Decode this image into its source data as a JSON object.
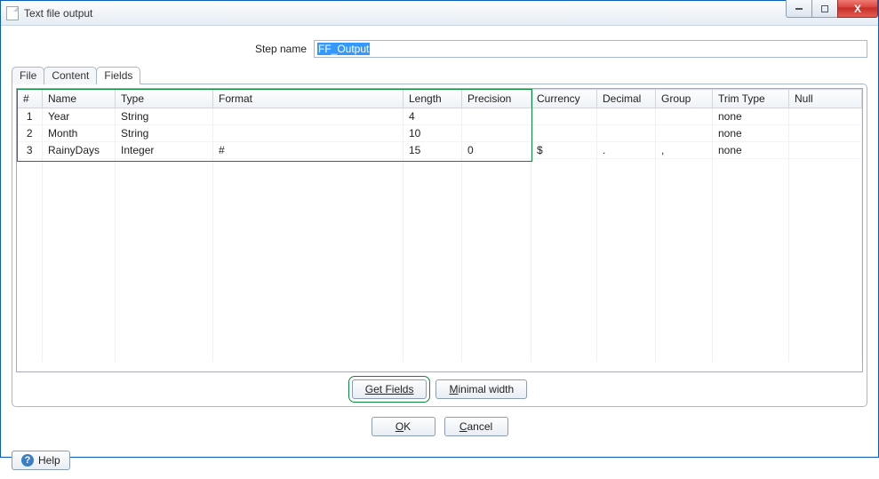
{
  "window": {
    "title": "Text file output"
  },
  "step": {
    "label": "Step name",
    "value": "FF_Output"
  },
  "tabs": [
    {
      "label": "File",
      "active": false
    },
    {
      "label": "Content",
      "active": false
    },
    {
      "label": "Fields",
      "active": true
    }
  ],
  "grid": {
    "columns": [
      "#",
      "Name",
      "Type",
      "Format",
      "Length",
      "Precision",
      "Currency",
      "Decimal",
      "Group",
      "Trim Type",
      "Null"
    ],
    "rows": [
      {
        "idx": "1",
        "name": "Year",
        "type": "String",
        "format": "",
        "length": "4",
        "precision": "",
        "currency": "",
        "decimal": "",
        "group": "",
        "trim": "none",
        "null": ""
      },
      {
        "idx": "2",
        "name": "Month",
        "type": "String",
        "format": "",
        "length": "10",
        "precision": "",
        "currency": "",
        "decimal": "",
        "group": "",
        "trim": "none",
        "null": ""
      },
      {
        "idx": "3",
        "name": "RainyDays",
        "type": "Integer",
        "format": "#",
        "length": "15",
        "precision": "0",
        "currency": "$",
        "decimal": ".",
        "group": ",",
        "trim": "none",
        "null": ""
      }
    ]
  },
  "buttons": {
    "get_fields": "Get Fields",
    "minimal_width": "Minimal width",
    "ok": "OK",
    "cancel": "Cancel",
    "help": "Help"
  }
}
